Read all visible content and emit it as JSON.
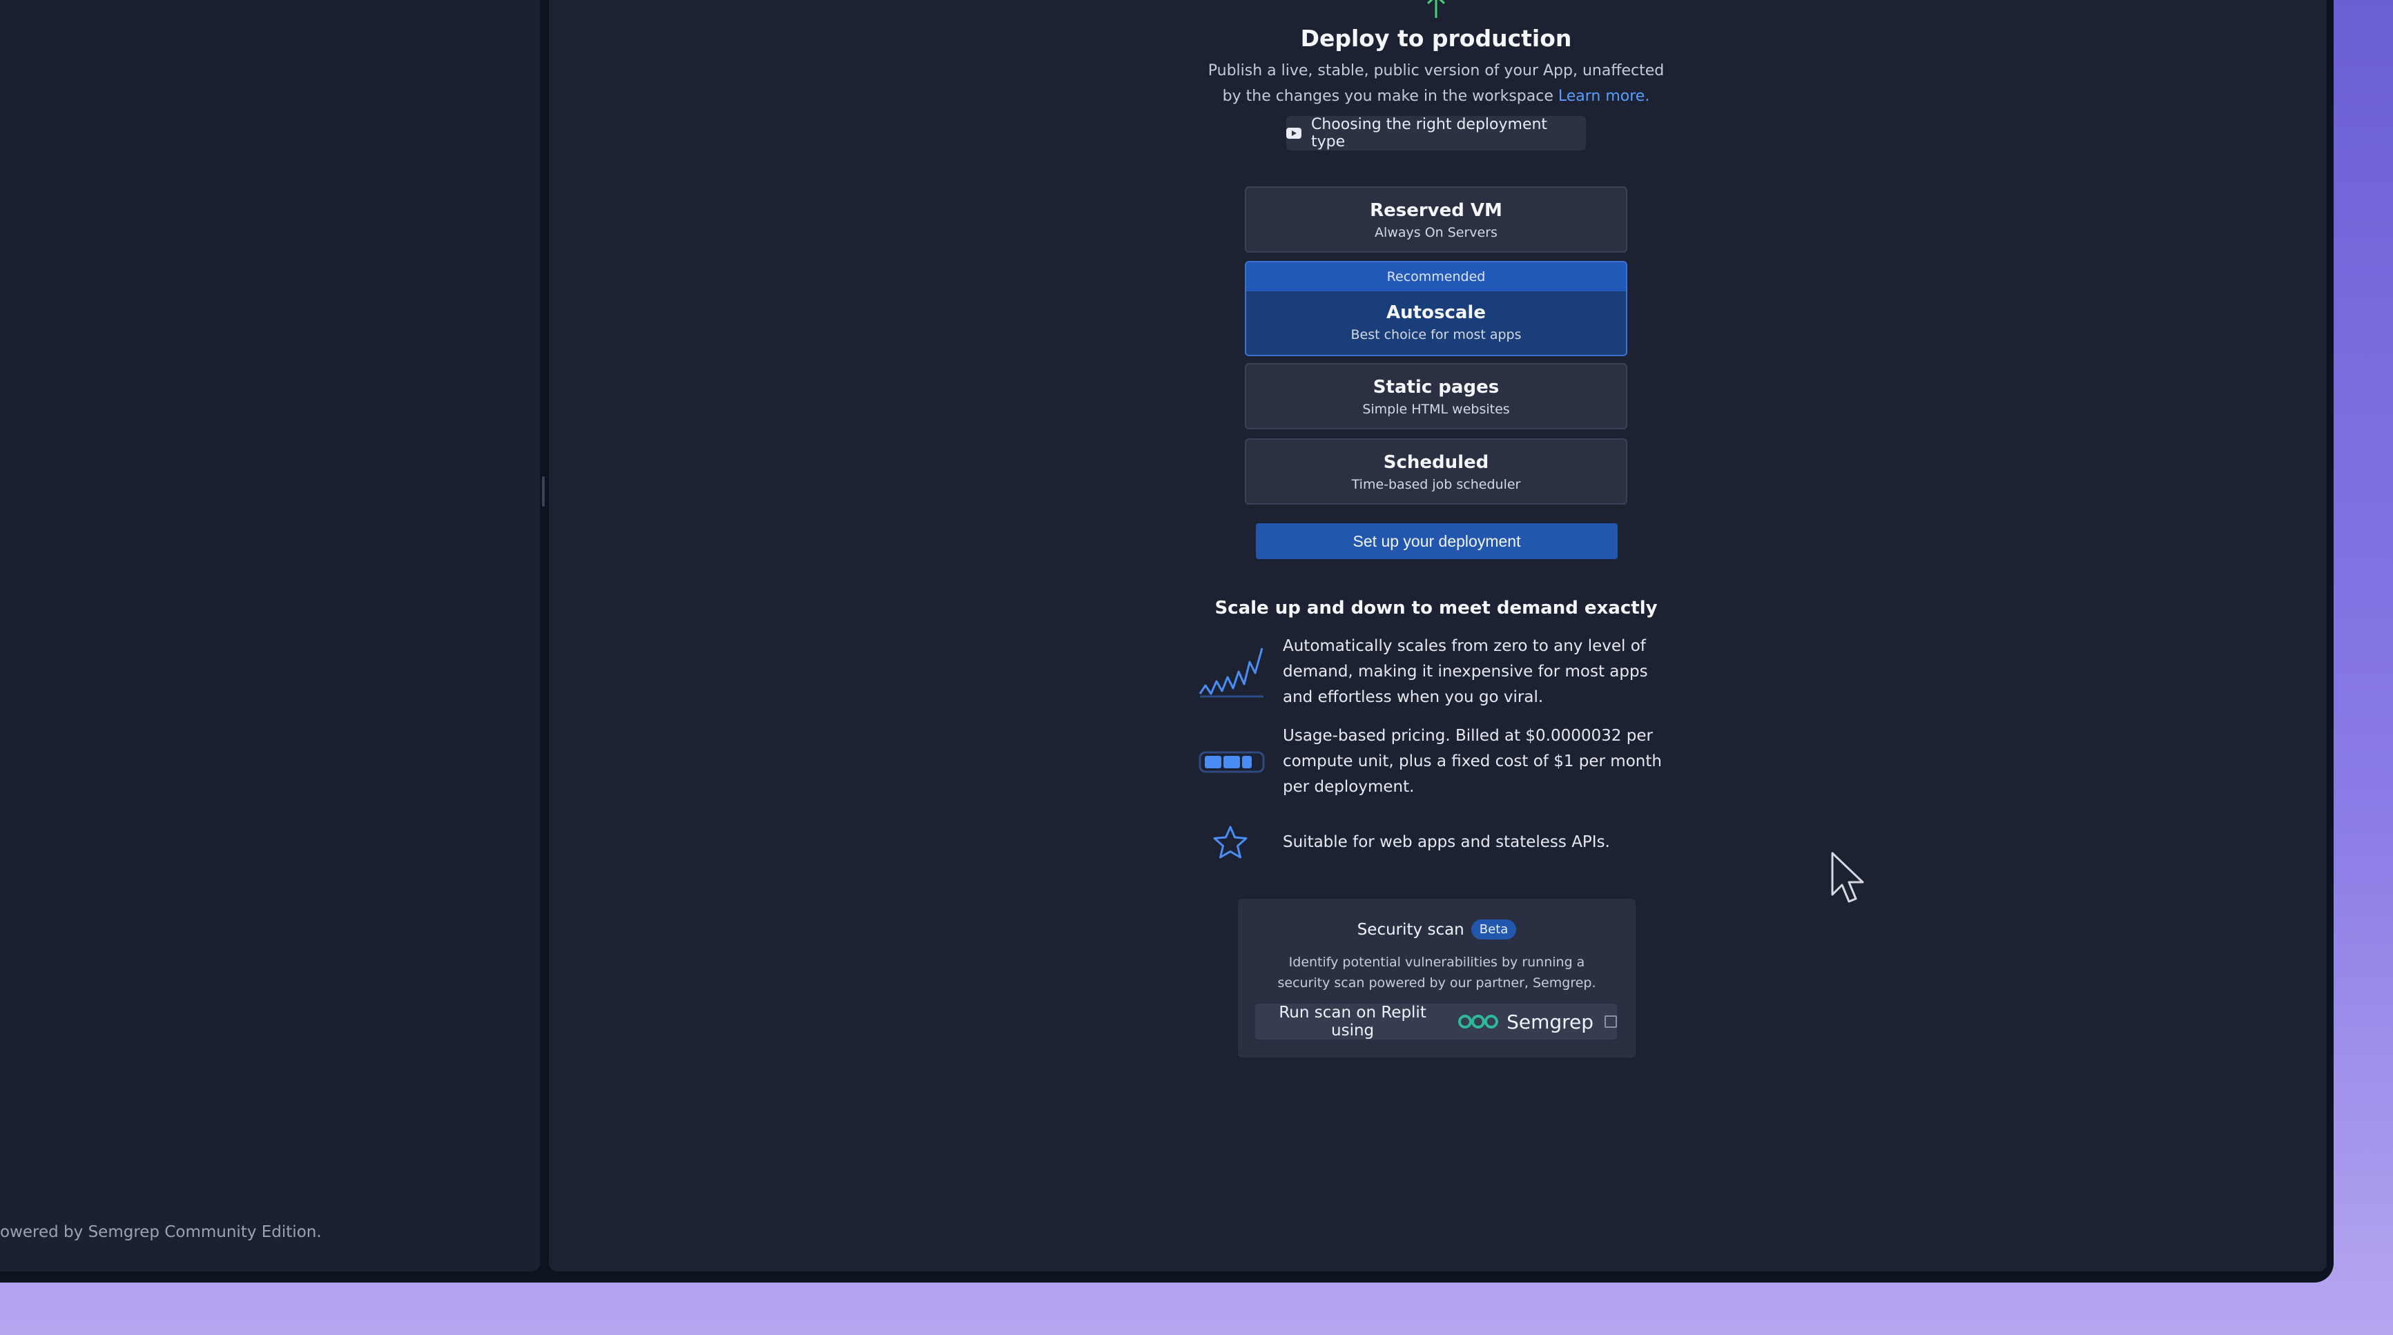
{
  "left_panel": {
    "footer": "owered by Semgrep Community Edition."
  },
  "header": {
    "title": "Deploy to production",
    "description": "Publish a live, stable, public version of your App, unaffected by the changes you make in the workspace",
    "learn_more": "Learn more.",
    "video_chip": "Choosing the right deployment type"
  },
  "options": [
    {
      "name": "Reserved VM",
      "sub": "Always On Servers"
    },
    {
      "badge": "Recommended",
      "name": "Autoscale",
      "sub": "Best choice for most apps",
      "selected": true
    },
    {
      "name": "Static pages",
      "sub": "Simple HTML websites"
    },
    {
      "name": "Scheduled",
      "sub": "Time-based job scheduler"
    }
  ],
  "setup_button": "Set up your deployment",
  "features": {
    "title": "Scale up and down to meet demand exactly",
    "items": [
      {
        "icon": "autoscale-chart-icon",
        "text": "Automatically scales from zero to any level of demand, making it inexpensive for most apps and effortless when you go viral."
      },
      {
        "icon": "compute-units-icon",
        "text": "Usage-based pricing. Billed at $0.0000032 per compute unit, plus a fixed cost of $1 per month per deployment."
      },
      {
        "icon": "star-icon",
        "text": "Suitable for web apps and stateless APIs."
      }
    ]
  },
  "security": {
    "title": "Security scan",
    "badge": "Beta",
    "description": "Identify potential vulnerabilities by running a security scan powered by our partner, Semgrep.",
    "button_label": "Run scan on Replit using",
    "brand": "Semgrep"
  },
  "colors": {
    "accent": "#2357ad",
    "link": "#5a9cff",
    "semgrep": "#2fb89a",
    "icon_blue": "#4a8df5"
  }
}
